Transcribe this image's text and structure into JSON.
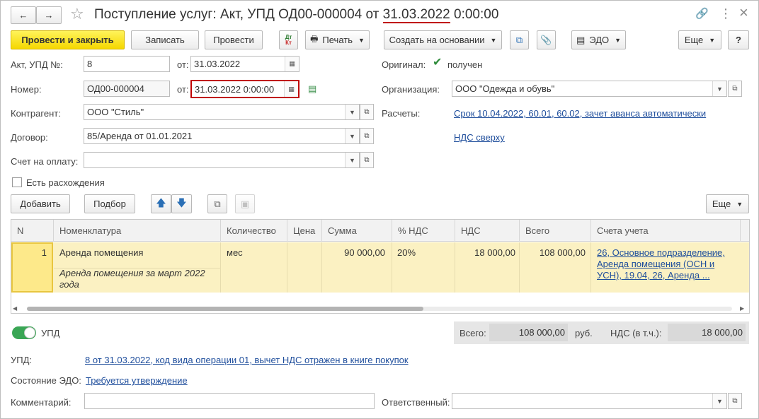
{
  "window": {
    "title_prefix": "Поступление услуг: Акт, УПД ОД00-000004 от ",
    "title_date": "31.03.2022",
    "title_suffix": " 0:00:00",
    "nav_back": "←",
    "nav_forward": "→",
    "star": "☆",
    "link_icon": "🔗",
    "more_icon": "⋮",
    "close_icon": "×"
  },
  "toolbar": {
    "post_close": "Провести и закрыть",
    "save": "Записать",
    "post": "Провести",
    "dtkt_top": "Дт",
    "dtkt_bottom": "Кт",
    "print": "Печать",
    "create_based": "Создать на основании",
    "edo": "ЭДО",
    "more": "Еще",
    "help": "?"
  },
  "form": {
    "act_label": "Акт, УПД №:",
    "act_value": "8",
    "from_label": "от:",
    "act_date": "31.03.2022",
    "number_label": "Номер:",
    "number_value": "ОД00-000004",
    "number_date": "31.03.2022  0:00:00",
    "counterparty_label": "Контрагент:",
    "counterparty_value": "ООО \"Стиль\"",
    "contract_label": "Договор:",
    "contract_value": "85/Аренда от 01.01.2021",
    "invoice_label": "Счет на оплату:",
    "invoice_value": "",
    "discrepancies_label": "Есть расхождения",
    "original_label": "Оригинал:",
    "original_value": "получен",
    "org_label": "Организация:",
    "org_value": "ООО \"Одежда и обувь\"",
    "settlements_label": "Расчеты:",
    "settlements_link": "Срок 10.04.2022, 60.01, 60.02, зачет аванса автоматически",
    "vat_link": "НДС сверху"
  },
  "table_toolbar": {
    "add": "Добавить",
    "select": "Подбор",
    "more": "Еще"
  },
  "table": {
    "columns": [
      "N",
      "Номенклатура",
      "Количество",
      "Цена",
      "Сумма",
      "% НДС",
      "НДС",
      "Всего",
      "Счета учета"
    ],
    "rows": [
      {
        "n": "1",
        "name": "Аренда помещения",
        "desc_line1": "Аренда помещения за март 2022",
        "desc_line2": "года",
        "qty": "мес",
        "price": "",
        "sum": "90 000,00",
        "vat_rate": "20%",
        "vat": "18 000,00",
        "total": "108 000,00",
        "accounts_line1": "26, Основное подразделение,",
        "accounts_line2": "Аренда помещения (ОСН и",
        "accounts_line3": "УСН), 19.04, 26, Аренда ..."
      }
    ]
  },
  "footer": {
    "upd_toggle_label": "УПД",
    "total_label": "Всего:",
    "total_value": "108 000,00",
    "currency": "руб.",
    "vat_incl_label": "НДС (в т.ч.):",
    "vat_incl_value": "18 000,00",
    "upd_label": "УПД:",
    "upd_link": "8 от 31.03.2022, код вида операции 01, вычет НДС отражен в книге покупок",
    "edo_state_label": "Состояние ЭДО:",
    "edo_state_link": "Требуется утверждение",
    "comment_label": "Комментарий:",
    "comment_value": "",
    "responsible_label": "Ответственный:",
    "responsible_value": ""
  },
  "colors": {
    "primary_button": "#f5d700",
    "link": "#1f4e9c",
    "selected_row": "#fbf1c2",
    "highlight_border": "#c00000",
    "toggle_on": "#3aa655"
  }
}
